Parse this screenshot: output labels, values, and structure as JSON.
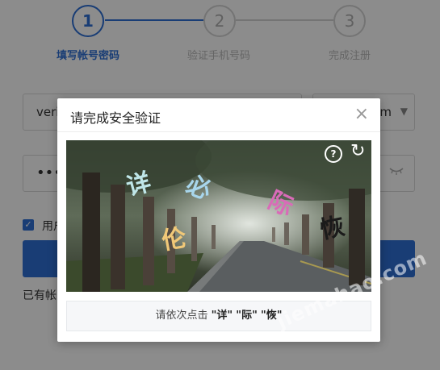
{
  "steps": [
    {
      "number": "1",
      "label": "填写帐号密码"
    },
    {
      "number": "2",
      "label": "验证手机号码"
    },
    {
      "number": "3",
      "label": "完成注册"
    }
  ],
  "form": {
    "account_value": "verit",
    "domain_suffix": "om",
    "password_mask": "•••",
    "agree_text": "用户",
    "has_account_text": "已有帐"
  },
  "modal": {
    "title": "请完成安全验证",
    "close_glyph": "×",
    "help_glyph": "?",
    "refresh_glyph": "↻",
    "captcha_chars": [
      "详",
      "必",
      "伦",
      "际",
      "恢"
    ],
    "instruction_prefix": "请依次点击",
    "targets": [
      "\"详\"",
      "\"际\"",
      "\"恢\""
    ]
  },
  "watermark": "jiemahao.com",
  "colors": {
    "accent": "#2e6fd6",
    "inactive": "#d4d4d4"
  }
}
